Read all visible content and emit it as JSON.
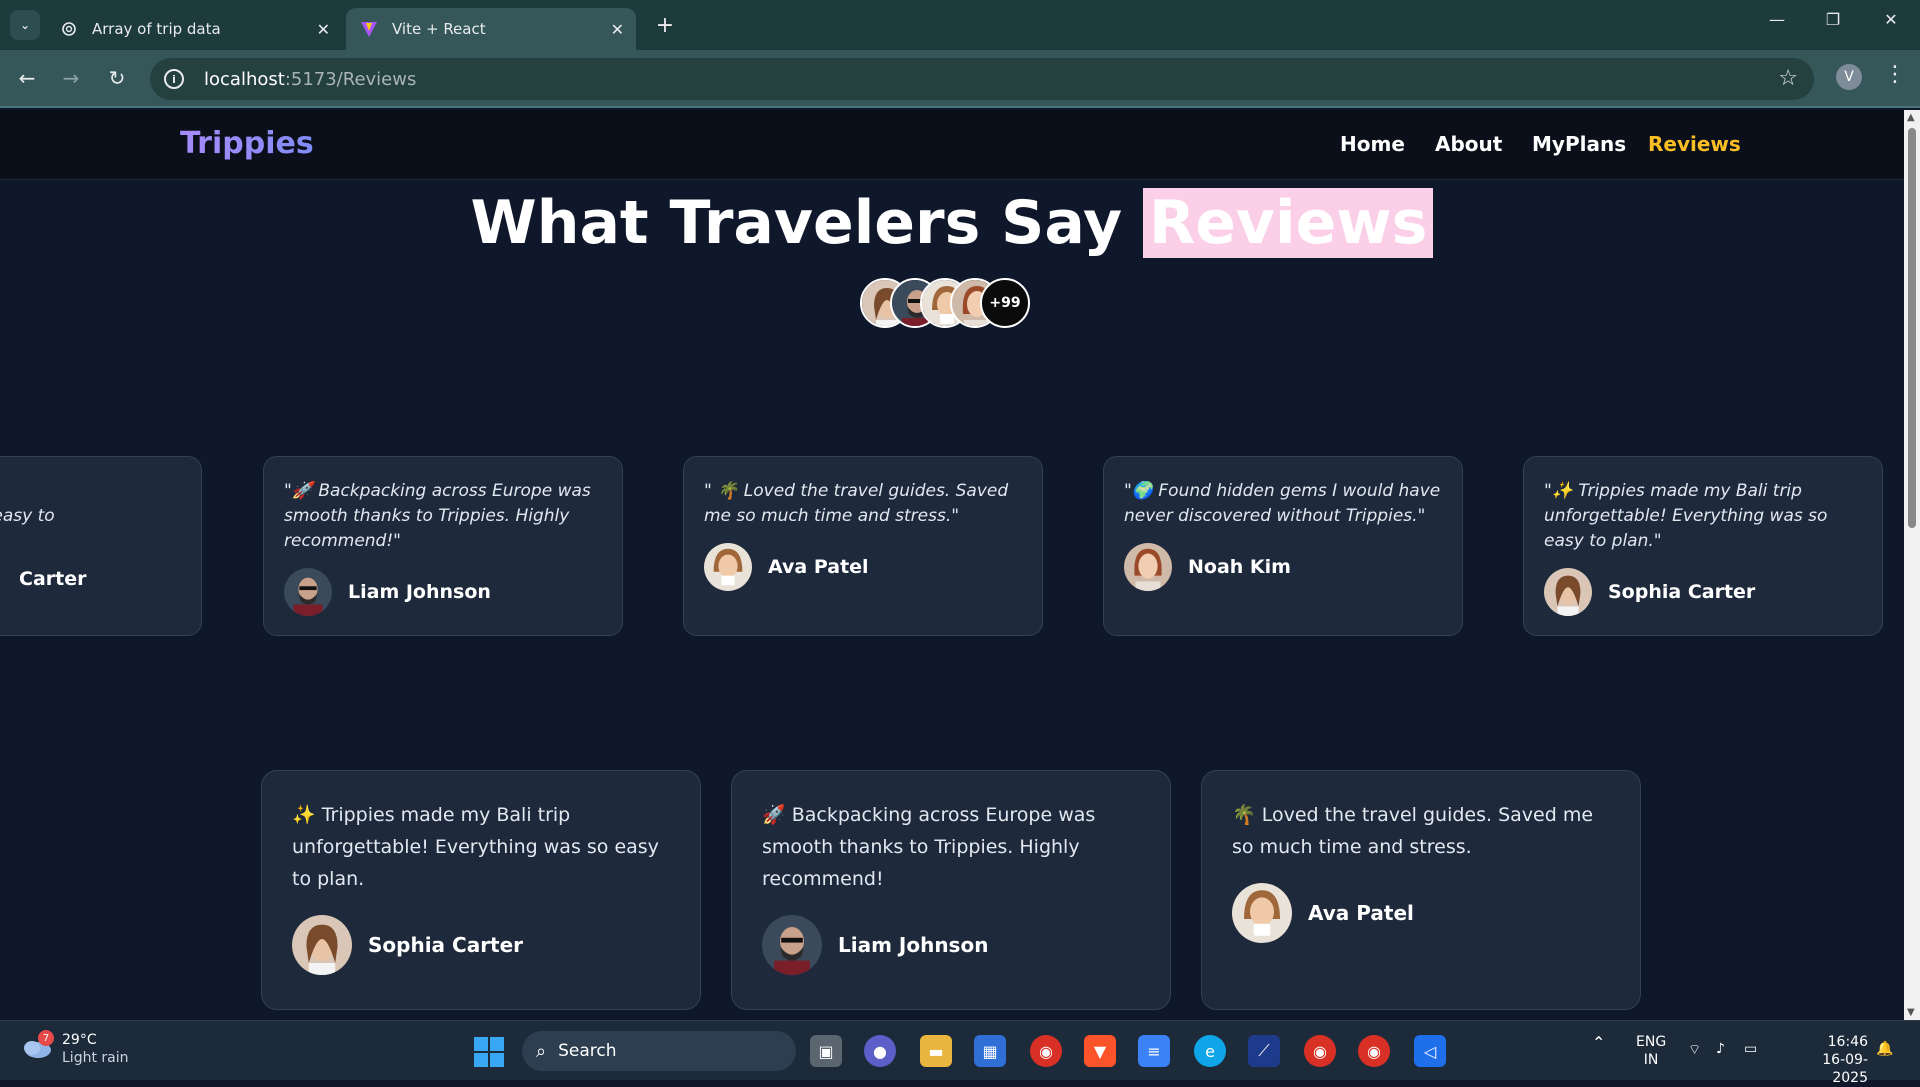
{
  "browser": {
    "tabs": [
      {
        "title": "Array of trip data",
        "icon": "chatgpt-icon"
      },
      {
        "title": "Vite + React",
        "icon": "vite-icon"
      }
    ],
    "url_host": "localhost",
    "url_path": ":5173/Reviews",
    "profile_initial": "V"
  },
  "nav": {
    "brand": "Trippies",
    "links": [
      "Home",
      "About",
      "MyPlans",
      "Reviews"
    ],
    "active": "Reviews"
  },
  "hero": {
    "title": "What Travelers Say",
    "highlight": "Reviews",
    "avatar_more": "+99"
  },
  "marquee": [
    {
      "quote": "e my Bali trip\nrything was so easy to",
      "name": "Carter"
    },
    {
      "quote": "\"🚀 Backpacking across Europe was smooth thanks to Trippies. Highly recommend!\"",
      "name": "Liam Johnson"
    },
    {
      "quote": "\" 🌴 Loved the travel guides. Saved me so much time and stress.\"",
      "name": "Ava Patel"
    },
    {
      "quote": "\"🌍 Found hidden gems I would have never discovered without Trippies.\"",
      "name": "Noah Kim"
    },
    {
      "quote": "\"✨ Trippies made my Bali trip unforgettable! Everything was so easy to plan.\"",
      "name": "Sophia Carter"
    }
  ],
  "grid": [
    {
      "quote": "✨ Trippies made my Bali trip unforgettable! Everything was so easy to plan.",
      "name": "Sophia Carter"
    },
    {
      "quote": "🚀 Backpacking across Europe was smooth thanks to Trippies. Highly recommend!",
      "name": "Liam Johnson"
    },
    {
      "quote": "🌴 Loved the travel guides. Saved me so much time and stress.",
      "name": "Ava Patel"
    }
  ],
  "taskbar": {
    "temp": "29°C",
    "condition": "Light rain",
    "weather_badge": "7",
    "search_label": "Search",
    "lang": "ENG",
    "region": "IN",
    "time": "16:46",
    "date": "16-09-2025"
  }
}
